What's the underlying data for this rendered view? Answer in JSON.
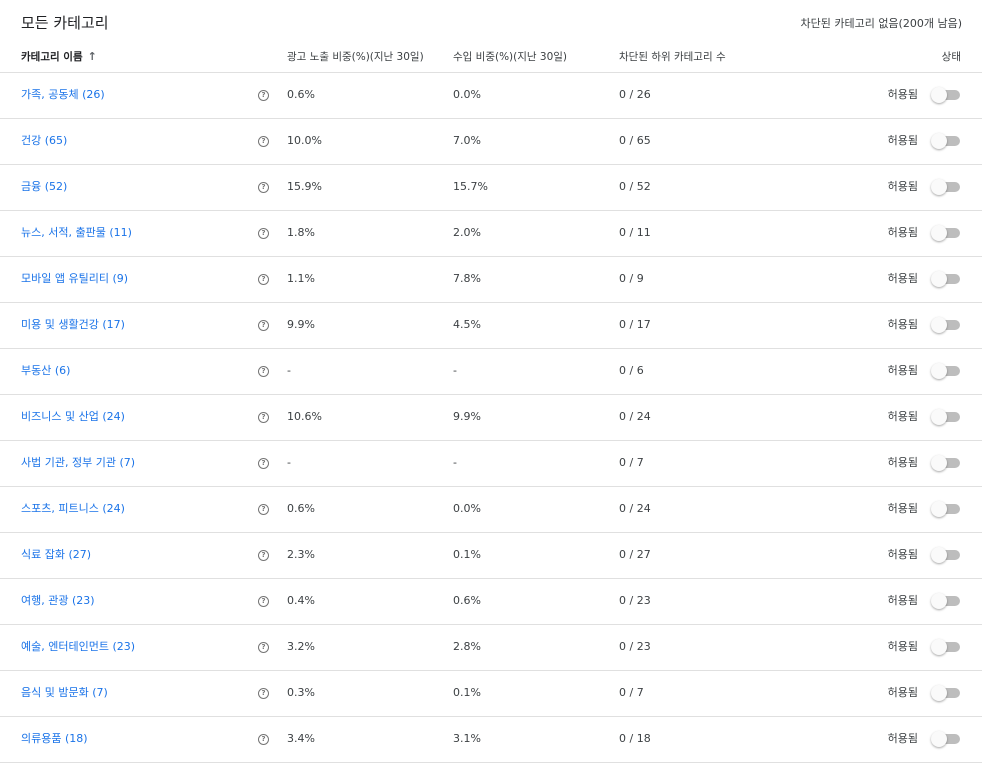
{
  "page": {
    "title": "모든 카테고리",
    "blocked_summary": "차단된 카테고리 없음(200개 남음)"
  },
  "header": {
    "name": "카테고리 이름",
    "sort_icon": "↑",
    "impressions": "광고 노출 비중(%)(지난 30일)",
    "revenue": "수입 비중(%)(지난 30일)",
    "blocked_sub": "차단된 하위 카테고리 수",
    "status": "상태"
  },
  "icons": {
    "help": "?",
    "help_name": "help-circle-icon",
    "toggle_name": "toggle-switch"
  },
  "colors": {
    "link": "#1a73e8",
    "divider": "#e0e0e0",
    "toggle_off_track": "#bdbdbd"
  },
  "rows": [
    {
      "name": "가족, 공동체 (26)",
      "impressions": "0.6%",
      "revenue": "0.0%",
      "blocked": "0 / 26",
      "status": "허용됨",
      "blocked_on": false
    },
    {
      "name": "건강 (65)",
      "impressions": "10.0%",
      "revenue": "7.0%",
      "blocked": "0 / 65",
      "status": "허용됨",
      "blocked_on": false
    },
    {
      "name": "금융 (52)",
      "impressions": "15.9%",
      "revenue": "15.7%",
      "blocked": "0 / 52",
      "status": "허용됨",
      "blocked_on": false
    },
    {
      "name": "뉴스, 서적, 출판물 (11)",
      "impressions": "1.8%",
      "revenue": "2.0%",
      "blocked": "0 / 11",
      "status": "허용됨",
      "blocked_on": false
    },
    {
      "name": "모바일 앱 유틸리티 (9)",
      "impressions": "1.1%",
      "revenue": "7.8%",
      "blocked": "0 / 9",
      "status": "허용됨",
      "blocked_on": false
    },
    {
      "name": "미용 및 생활건강 (17)",
      "impressions": "9.9%",
      "revenue": "4.5%",
      "blocked": "0 / 17",
      "status": "허용됨",
      "blocked_on": false
    },
    {
      "name": "부동산 (6)",
      "impressions": "-",
      "revenue": "-",
      "blocked": "0 / 6",
      "status": "허용됨",
      "blocked_on": false
    },
    {
      "name": "비즈니스 및 산업 (24)",
      "impressions": "10.6%",
      "revenue": "9.9%",
      "blocked": "0 / 24",
      "status": "허용됨",
      "blocked_on": false
    },
    {
      "name": "사법 기관, 정부 기관 (7)",
      "impressions": "-",
      "revenue": "-",
      "blocked": "0 / 7",
      "status": "허용됨",
      "blocked_on": false
    },
    {
      "name": "스포츠, 피트니스 (24)",
      "impressions": "0.6%",
      "revenue": "0.0%",
      "blocked": "0 / 24",
      "status": "허용됨",
      "blocked_on": false
    },
    {
      "name": "식료 잡화 (27)",
      "impressions": "2.3%",
      "revenue": "0.1%",
      "blocked": "0 / 27",
      "status": "허용됨",
      "blocked_on": false
    },
    {
      "name": "여행, 관광 (23)",
      "impressions": "0.4%",
      "revenue": "0.6%",
      "blocked": "0 / 23",
      "status": "허용됨",
      "blocked_on": false
    },
    {
      "name": "예술, 엔터테인먼트 (23)",
      "impressions": "3.2%",
      "revenue": "2.8%",
      "blocked": "0 / 23",
      "status": "허용됨",
      "blocked_on": false
    },
    {
      "name": "음식 및 밤문화 (7)",
      "impressions": "0.3%",
      "revenue": "0.1%",
      "blocked": "0 / 7",
      "status": "허용됨",
      "blocked_on": false
    },
    {
      "name": "의류용품 (18)",
      "impressions": "3.4%",
      "revenue": "3.1%",
      "blocked": "0 / 18",
      "status": "허용됨",
      "blocked_on": false
    }
  ]
}
